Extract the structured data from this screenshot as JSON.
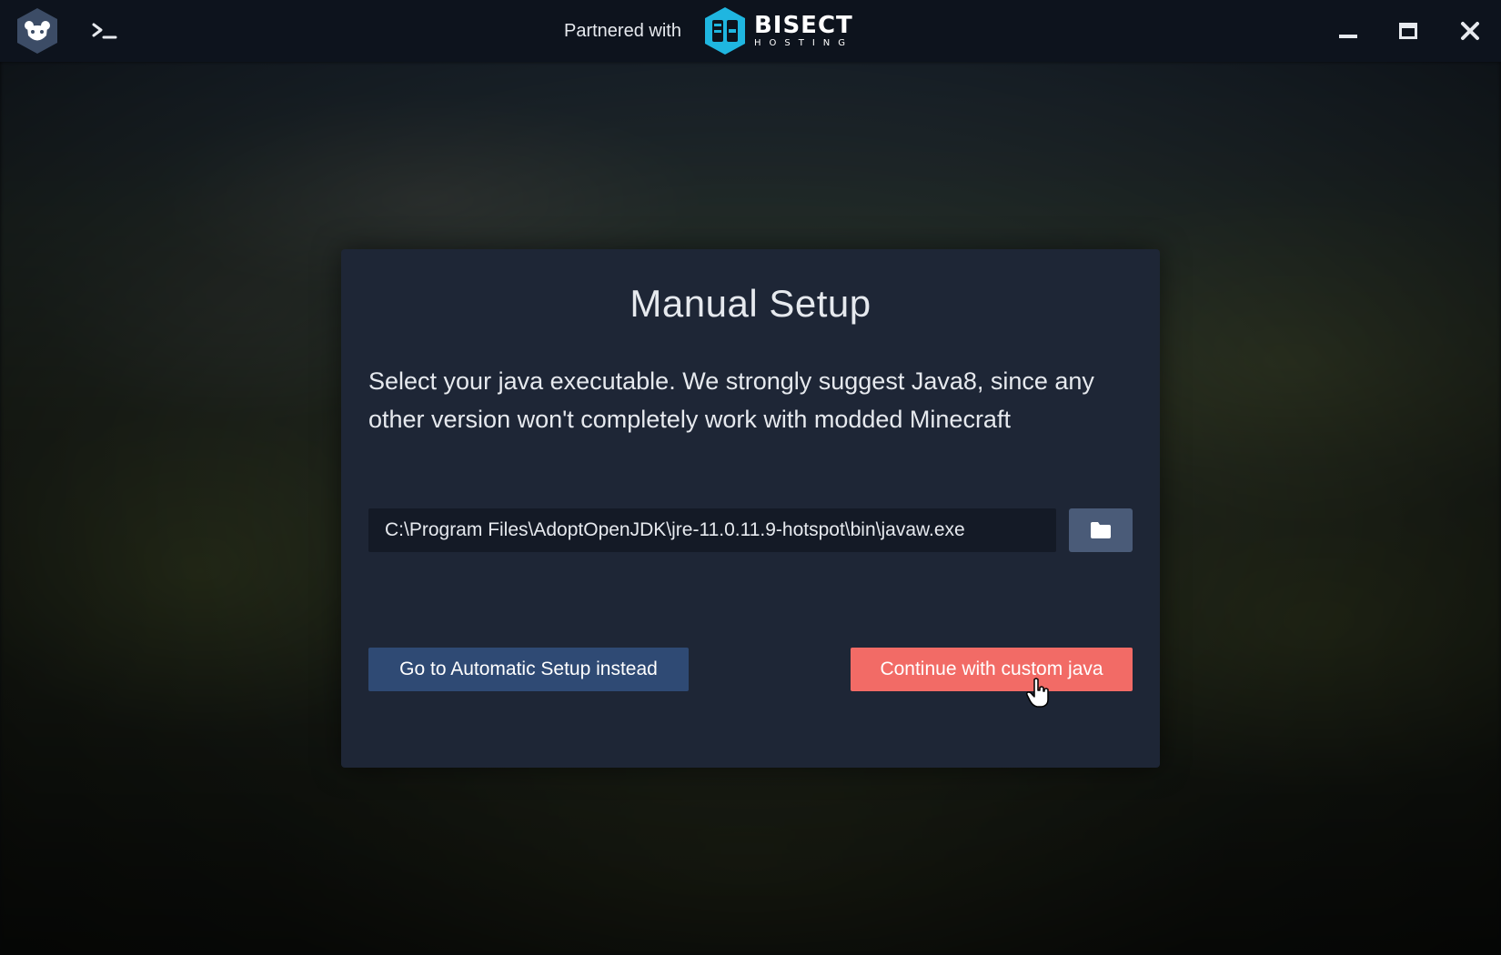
{
  "titlebar": {
    "partner_text": "Partnered with",
    "partner_brand": "BISECT",
    "partner_brand_sub": "HOSTING",
    "icons": [
      "app-logo-icon",
      "terminal-icon",
      "minimize-icon",
      "maximize-icon",
      "close-icon"
    ]
  },
  "dialog": {
    "title": "Manual Setup",
    "description": "Select your java executable. We strongly suggest Java8, since any other version won't completely work with modded Minecraft",
    "java_path": "C:\\Program Files\\AdoptOpenJDK\\jre-11.0.11.9-hotspot\\bin\\javaw.exe",
    "folder_button_icon": "folder-icon",
    "auto_setup_label": "Go to Automatic Setup instead",
    "continue_label": "Continue with custom java"
  },
  "colors": {
    "titlebar_bg": "#0d131d",
    "dialog_bg": "#1e2636",
    "input_bg": "#141a26",
    "folder_button_bg": "#4a5b78",
    "auto_button_bg": "#2f4a74",
    "continue_button_bg": "#f26b66",
    "brand_cyan": "#1fb6e0"
  }
}
